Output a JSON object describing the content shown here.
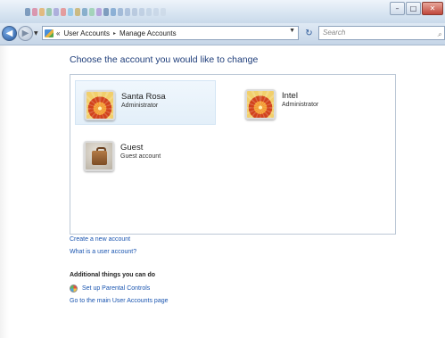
{
  "window": {
    "minimize_glyph": "–",
    "maximize_glyph": "□",
    "close_glyph": "✕"
  },
  "address_bar": {
    "overflow_chevron": "«",
    "breadcrumbs": [
      "User Accounts",
      "Manage Accounts"
    ],
    "separator": "▸",
    "refresh_glyph": "↻",
    "search_placeholder": "Search"
  },
  "main": {
    "heading": "Choose the account you would like to change",
    "accounts": [
      {
        "name": "Santa Rosa",
        "role": "Administrator",
        "avatar": "flower-icon",
        "hovered": true
      },
      {
        "name": "Intel",
        "role": "Administrator",
        "avatar": "flower-icon",
        "hovered": false
      },
      {
        "name": "Guest",
        "role": "Guest account",
        "avatar": "briefcase-icon",
        "hovered": false
      }
    ],
    "links": {
      "create": "Create a new account",
      "what_is": "What is a user account?"
    },
    "additional": {
      "heading": "Additional things you can do",
      "parental": "Set up Parental Controls",
      "main_page": "Go to the main User Accounts page"
    }
  },
  "colors": {
    "heading": "#1e3d7a",
    "link": "#1a55b0",
    "hover_bg": "#e3eff9"
  }
}
